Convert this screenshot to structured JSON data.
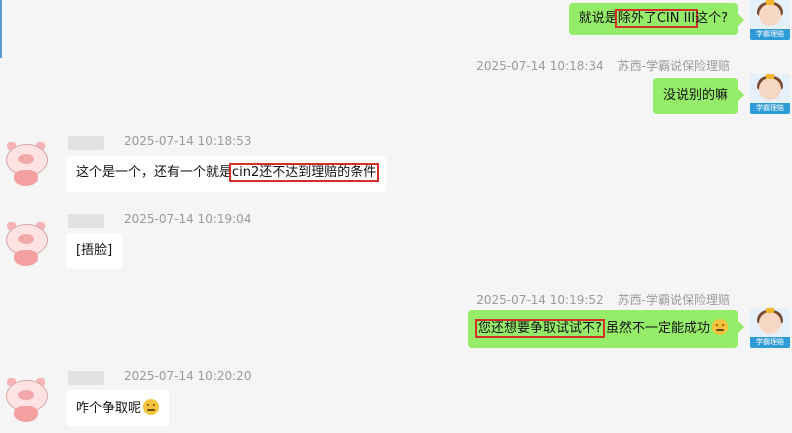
{
  "messages": [
    {
      "side": "me",
      "text_pre": "就说是",
      "highlight": "除外了CIN III",
      "text_post": "这个?"
    },
    {
      "meta": {
        "time": "2025-07-14 10:18:34",
        "name": "苏西-学霸说保险理赔"
      },
      "side": "me",
      "text": "没说别的嘛"
    },
    {
      "meta": {
        "time": "2025-07-14 10:18:53"
      },
      "side": "other",
      "text_pre": "这个是一个，还有一个就是",
      "highlight": "cin2还不达到理赔的条件",
      "text_post": ""
    },
    {
      "meta": {
        "time": "2025-07-14 10:19:04"
      },
      "side": "other",
      "text": "[捂脸]"
    },
    {
      "meta": {
        "time": "2025-07-14 10:19:52",
        "name": "苏西-学霸说保险理赔"
      },
      "side": "me",
      "text_pre": "",
      "highlight": "您还想要争取试试不?",
      "text_post": "虽然不一定能成功",
      "emoji": "thinking-emoji"
    },
    {
      "meta": {
        "time": "2025-07-14 10:20:20"
      },
      "side": "other",
      "text": "咋个争取呢",
      "emoji": "thinking-emoji"
    }
  ],
  "my_avatar_tag": "学霸理赔",
  "colors": {
    "my_bubble": "#95ec69",
    "other_bubble": "#ffffff",
    "highlight_box": "#d3302a",
    "meta_text": "#9a9a9a",
    "background": "#f5f5f5"
  }
}
